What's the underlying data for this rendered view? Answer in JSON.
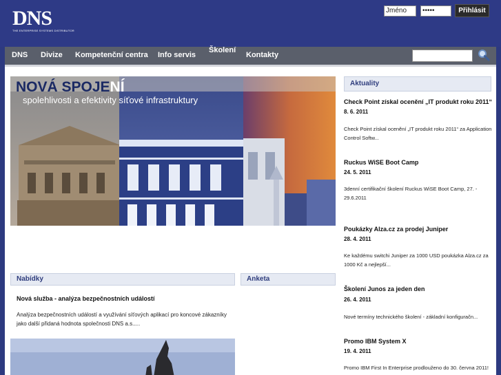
{
  "header": {
    "logo_text": "DNS",
    "logo_tagline": "THE ENTERPRISE SYSTEMS DISTRIBUTOR",
    "login": {
      "username_value": "Jméno",
      "password_value": "•••••",
      "button_label": "Přihlásit"
    }
  },
  "nav": {
    "items": [
      {
        "label": "DNS"
      },
      {
        "label": "Divize"
      },
      {
        "label": "Kompetenční centra"
      },
      {
        "label": "Info servis"
      },
      {
        "label": "Školení"
      },
      {
        "label": "Kontakty"
      }
    ],
    "search_icon": "search-icon"
  },
  "banner": {
    "title_main": "NOVÁ SPOJE",
    "title_accent": "NÍ",
    "subtitle": "spolehlivosti a efektivity síťové infrastruktury"
  },
  "nabidky": {
    "heading": "Nabídky",
    "item_title": "Nová služba - analýza bezpečnostních událostí",
    "item_text": "Analýza bezpečnostních událostí a využívání síťových aplikací pro koncové zákazníky jako další přidaná hodnota společnosti DNS a.s....."
  },
  "anketa": {
    "heading": "Anketa"
  },
  "aktuality": {
    "heading": "Aktuality",
    "items": [
      {
        "title": "Check Point získal ocenění „IT produkt roku 2011“",
        "date": "8. 6. 2011",
        "text": "Check Point získal ocenění „IT produkt roku 2011“ za Application Control Softw..."
      },
      {
        "title": "Ruckus WiSE Boot Camp",
        "date": "24. 5. 2011",
        "text": "3denní certifikační školení Ruckus WiSE Boot Camp, 27. - 29.6.2011"
      },
      {
        "title": "Poukázky Alza.cz za prodej Juniper",
        "date": "28. 4. 2011",
        "text": "Ke každému switchi Juniper za 1000 USD poukázka Alza.cz za 1000 Kč a nejlepší..."
      },
      {
        "title": "Školení Junos za jeden den",
        "date": "26. 4. 2011",
        "text": "Nové termíny technického školení - základní konfiguračn..."
      },
      {
        "title": "Promo IBM System X",
        "date": "19. 4. 2011",
        "text": "Promo IBM First In Enterprise prodlouženo do 30. června 2011!"
      }
    ]
  }
}
